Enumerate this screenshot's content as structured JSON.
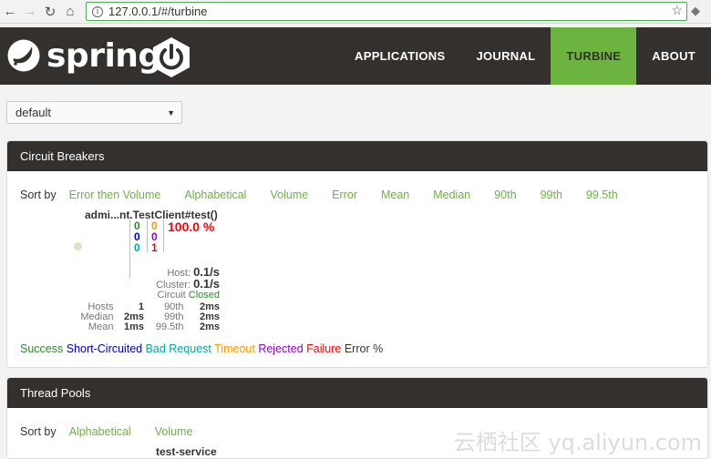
{
  "browser": {
    "url": "127.0.0.1/#/turbine"
  },
  "header": {
    "logo_text": "spring",
    "nav": [
      "APPLICATIONS",
      "JOURNAL",
      "TURBINE",
      "ABOUT"
    ],
    "active_index": 2
  },
  "selector": {
    "value": "default"
  },
  "circuit_panel": {
    "title": "Circuit Breakers",
    "sort_label": "Sort by",
    "sort_options": [
      "Error then Volume",
      "Alphabetical",
      "Volume",
      "Error",
      "Mean",
      "Median",
      "90th",
      "99th",
      "99.5th"
    ],
    "circuit": {
      "name": "admi...nt.TestClient#test()",
      "col1": [
        "0",
        "0",
        "0"
      ],
      "col2": [
        "0",
        "0",
        "1"
      ],
      "error_pct": "100.0 %",
      "host_label": "Host:",
      "host_rate": "0.1/s",
      "cluster_label": "Cluster:",
      "cluster_rate": "0.1/s",
      "circuit_label": "Circuit",
      "circuit_status": "Closed",
      "stats": [
        {
          "l1": "Hosts",
          "v1": "1",
          "l2": "90th",
          "v2": "2ms"
        },
        {
          "l1": "Median",
          "v1": "2ms",
          "l2": "99th",
          "v2": "2ms"
        },
        {
          "l1": "Mean",
          "v1": "1ms",
          "l2": "99.5th",
          "v2": "2ms"
        }
      ]
    },
    "legend": [
      {
        "text": "Success",
        "color": "#2a8a2a"
      },
      {
        "text": "Short-Circuited",
        "color": "#0000cc"
      },
      {
        "text": "Bad Request",
        "color": "#00aaaa"
      },
      {
        "text": "Timeout",
        "color": "#ff9900"
      },
      {
        "text": "Rejected",
        "color": "#9900cc"
      },
      {
        "text": "Failure",
        "color": "#ff0000"
      },
      {
        "text": "Error %",
        "color": "#333333"
      }
    ]
  },
  "thread_panel": {
    "title": "Thread Pools",
    "sort_label": "Sort by",
    "sort_options": [
      "Alphabetical",
      "Volume"
    ],
    "pool_name": "test-service"
  },
  "watermark": "云栖社区 yq.aliyun.com",
  "colors": {
    "accent": "#6db33f",
    "header_bg": "#34302d"
  }
}
